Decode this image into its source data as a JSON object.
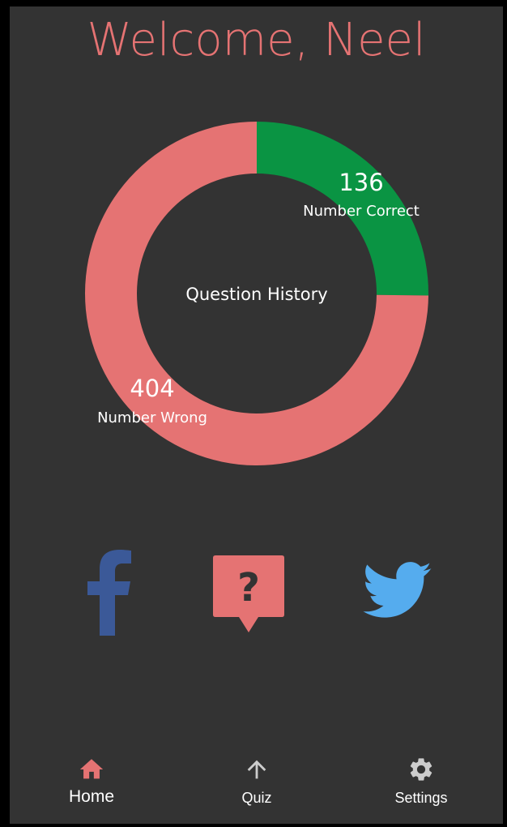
{
  "header": {
    "welcome_text": "Welcome, Neel"
  },
  "chart_data": {
    "type": "pie",
    "title": "Question History",
    "slices": [
      {
        "label": "Number Correct",
        "value": 136,
        "color": "#0a9443"
      },
      {
        "label": "Number Wrong",
        "value": 404,
        "color": "#e57373"
      }
    ]
  },
  "social": {
    "facebook_icon": "facebook-icon",
    "quiz_icon": "question-speech-bubble-icon",
    "twitter_icon": "twitter-icon"
  },
  "bottom_nav": {
    "items": [
      {
        "label": "Home",
        "icon": "home-icon",
        "active": true
      },
      {
        "label": "Quiz",
        "icon": "arrow-up-icon",
        "active": false
      },
      {
        "label": "Settings",
        "icon": "gear-icon",
        "active": false
      }
    ]
  },
  "colors": {
    "background": "#333333",
    "accent": "#e57373",
    "correct": "#0a9443",
    "facebook": "#3b5998",
    "twitter": "#55acee",
    "nav_inactive_icon": "#cccccc"
  }
}
